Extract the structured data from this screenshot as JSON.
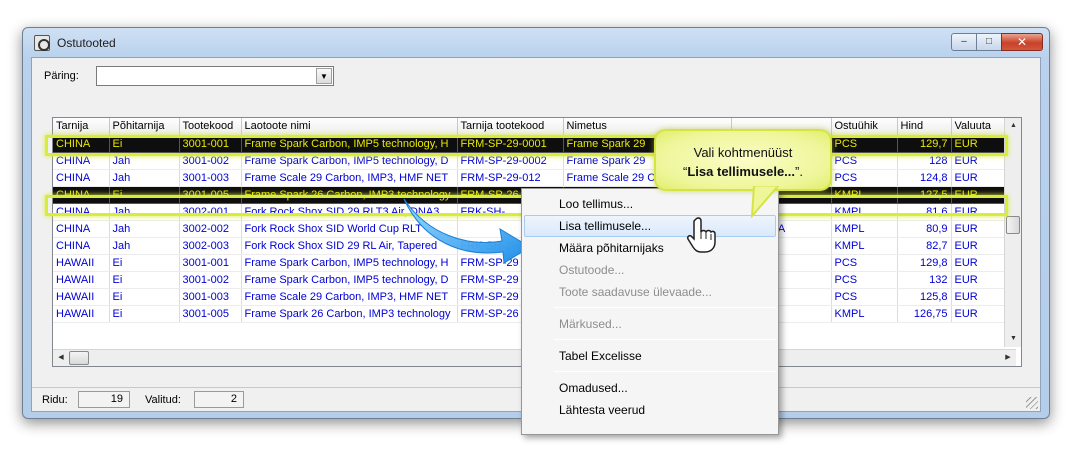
{
  "window": {
    "title": "Ostutooted",
    "min_label": "–",
    "max_label": "□",
    "close_label": "✕"
  },
  "query": {
    "label": "Päring:",
    "value": ""
  },
  "grid": {
    "columns": [
      "Tarnija",
      "Põhitarnija",
      "Tootekood",
      "Laotoote nimi",
      "Tarnija tootekood",
      "Nimetus",
      "",
      "Ostuühik",
      "Hind",
      "Valuuta"
    ],
    "rows": [
      [
        "CHINA",
        "Ei",
        "3001-001",
        "Frame Spark Carbon, IMP5 technology, H",
        "FRM-SP-29-0001",
        "Frame Spark 29",
        "",
        "PCS",
        "129,7",
        "EUR"
      ],
      [
        "CHINA",
        "Jah",
        "3001-002",
        "Frame Spark Carbon, IMP5 technology, D",
        "FRM-SP-29-0002",
        "Frame Spark 29",
        "",
        "PCS",
        "128",
        "EUR"
      ],
      [
        "CHINA",
        "Jah",
        "3001-003",
        "Frame Scale 29 Carbon, IMP3, HMF NET",
        "FRM-SP-29-012",
        "Frame Scale 29 C",
        "",
        "PCS",
        "124,8",
        "EUR"
      ],
      [
        "CHINA",
        "Ei",
        "3001-005",
        "Frame Spark 26 Carbon, IMP3 technology",
        "FRM-SP-26",
        "",
        "",
        "KMPL",
        "127,5",
        "EUR"
      ],
      [
        "CHINA",
        "Jah",
        "3002-001",
        "Fork Rock Shox SID 29 RLT3 Air, DNA3",
        "FRK-SH-",
        "",
        "",
        "KMPL",
        "81,6",
        "EUR"
      ],
      [
        "CHINA",
        "Jah",
        "3002-002",
        "Fork Rock Shox SID World Cup RLT",
        "",
        "",
        "3 Air, DNA",
        "KMPL",
        "80,9",
        "EUR"
      ],
      [
        "CHINA",
        "Jah",
        "3002-003",
        "Fork Rock Shox SID 29 RL Air, Tapered",
        "FRK-SH-29",
        "",
        "steerer",
        "KMPL",
        "82,7",
        "EUR"
      ],
      [
        "HAWAII",
        "Ei",
        "3001-001",
        "Frame Spark Carbon, IMP5 technology, H",
        "FRM-SP-29",
        "",
        "",
        "PCS",
        "129,8",
        "EUR"
      ],
      [
        "HAWAII",
        "Ei",
        "3001-002",
        "Frame Spark Carbon, IMP5 technology, D",
        "FRM-SP-29",
        "",
        "",
        "PCS",
        "132",
        "EUR"
      ],
      [
        "HAWAII",
        "Ei",
        "3001-003",
        "Frame Scale 29 Carbon, IMP3, HMF NET",
        "FRM-SP-29",
        "",
        "",
        "PCS",
        "125,8",
        "EUR"
      ],
      [
        "HAWAII",
        "Ei",
        "3001-005",
        "Frame Spark 26 Carbon, IMP3 technology",
        "FRM-SP-26",
        "",
        "",
        "KMPL",
        "126,75",
        "EUR"
      ]
    ],
    "selected_rows": [
      0,
      3
    ]
  },
  "status": {
    "rows_label": "Ridu:",
    "rows_value": "19",
    "selected_label": "Valitud:",
    "selected_value": "2"
  },
  "context_menu": {
    "items": [
      {
        "label": "Loo tellimus...",
        "enabled": true,
        "hover": false
      },
      {
        "label": "Lisa tellimusele...",
        "enabled": true,
        "hover": true
      },
      {
        "label": "Määra põhitarnijaks",
        "enabled": true,
        "hover": false
      },
      {
        "label": "Ostutoode...",
        "enabled": false,
        "hover": false
      },
      {
        "label": "Toote saadavuse ülevaade...",
        "enabled": false,
        "hover": false
      },
      {
        "separator": true
      },
      {
        "label": "Märkused...",
        "enabled": false,
        "hover": false
      },
      {
        "separator": true
      },
      {
        "label": "Tabel Excelisse",
        "enabled": true,
        "hover": false
      },
      {
        "separator": true
      },
      {
        "label": "Omadused...",
        "enabled": true,
        "hover": false
      },
      {
        "label": "Lähtesta veerud",
        "enabled": true,
        "hover": false
      }
    ]
  },
  "callout": {
    "line1": "Vali kohtmenüüst",
    "line2_quote_open": "“",
    "line2_bold": "Lisa tellimusele...",
    "line2_quote_close": "”."
  },
  "icons": {
    "window": "app-window-icon",
    "pointer": "hand-pointer-icon",
    "arrow": "blue-curved-arrow-icon"
  },
  "colors": {
    "selection_bg": "#0e0e0e",
    "selection_text": "#e8e800",
    "highlight": "#d9ec3b",
    "cell_text": "#0000d6",
    "callout_bg": "#eef69a"
  }
}
